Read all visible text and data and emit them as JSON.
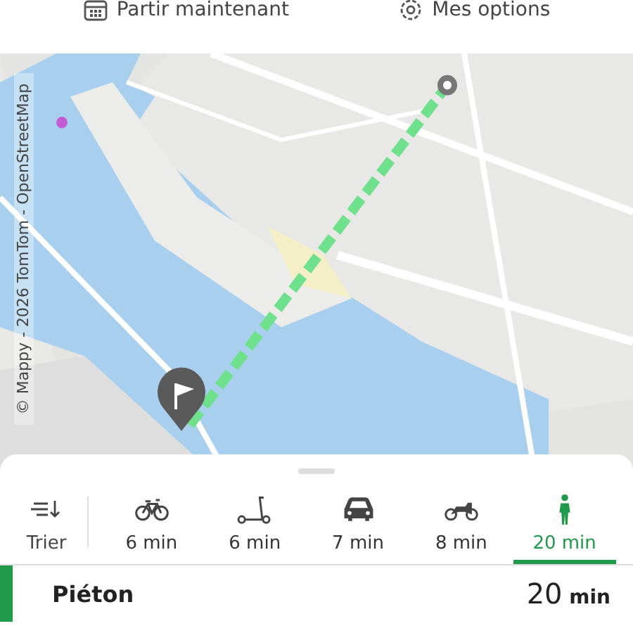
{
  "top_bar": {
    "departure": "Partir maintenant",
    "options": "Mes options"
  },
  "map": {
    "attribution": "© Mappy - 2026 TomTom - OpenStreetMap"
  },
  "sort": {
    "label": "Trier"
  },
  "modes": [
    {
      "kind": "bike",
      "duration": "6 min",
      "selected": false
    },
    {
      "kind": "scooter",
      "duration": "6 min",
      "selected": false
    },
    {
      "kind": "car",
      "duration": "7 min",
      "selected": false
    },
    {
      "kind": "motorbike",
      "duration": "8 min",
      "selected": false
    },
    {
      "kind": "walk",
      "duration": "20 min",
      "selected": true
    }
  ],
  "result": {
    "mode": "Piéton",
    "duration": "20",
    "unit": "min"
  }
}
